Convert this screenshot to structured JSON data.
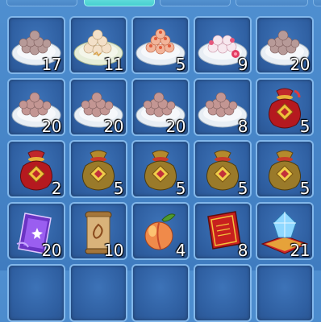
{
  "tabs": [
    {
      "name": "tab-1",
      "active": false
    },
    {
      "name": "tab-2",
      "active": true
    },
    {
      "name": "tab-3",
      "active": false
    },
    {
      "name": "tab-4",
      "active": false
    }
  ],
  "inventory": {
    "items": [
      {
        "icon": "dumplings-plate-icon",
        "count": "17"
      },
      {
        "icon": "glutinous-rice-balls-icon",
        "count": "11"
      },
      {
        "icon": "peach-buns-icon",
        "count": "5"
      },
      {
        "icon": "flower-rice-balls-icon",
        "count": "9"
      },
      {
        "icon": "dumplings-plate-icon",
        "count": "20"
      },
      {
        "icon": "dumplings-plate-icon",
        "count": "20"
      },
      {
        "icon": "dumplings-plate-icon",
        "count": "20"
      },
      {
        "icon": "dumplings-plate-icon",
        "count": "20"
      },
      {
        "icon": "dumplings-plate-icon",
        "count": "8"
      },
      {
        "icon": "red-lucky-bag-icon",
        "count": "5"
      },
      {
        "icon": "red-lucky-bag-icon",
        "count": "2"
      },
      {
        "icon": "gold-lucky-bag-icon",
        "count": "5"
      },
      {
        "icon": "gold-lucky-bag-icon",
        "count": "5"
      },
      {
        "icon": "gold-lucky-bag-icon",
        "count": "5"
      },
      {
        "icon": "gold-lucky-bag-icon",
        "count": "5"
      },
      {
        "icon": "purple-card-icon",
        "count": "20"
      },
      {
        "icon": "scroll-icon",
        "count": "10"
      },
      {
        "icon": "peach-icon",
        "count": "4"
      },
      {
        "icon": "red-book-icon",
        "count": "8"
      },
      {
        "icon": "crystal-cushion-icon",
        "count": "21"
      }
    ]
  }
}
